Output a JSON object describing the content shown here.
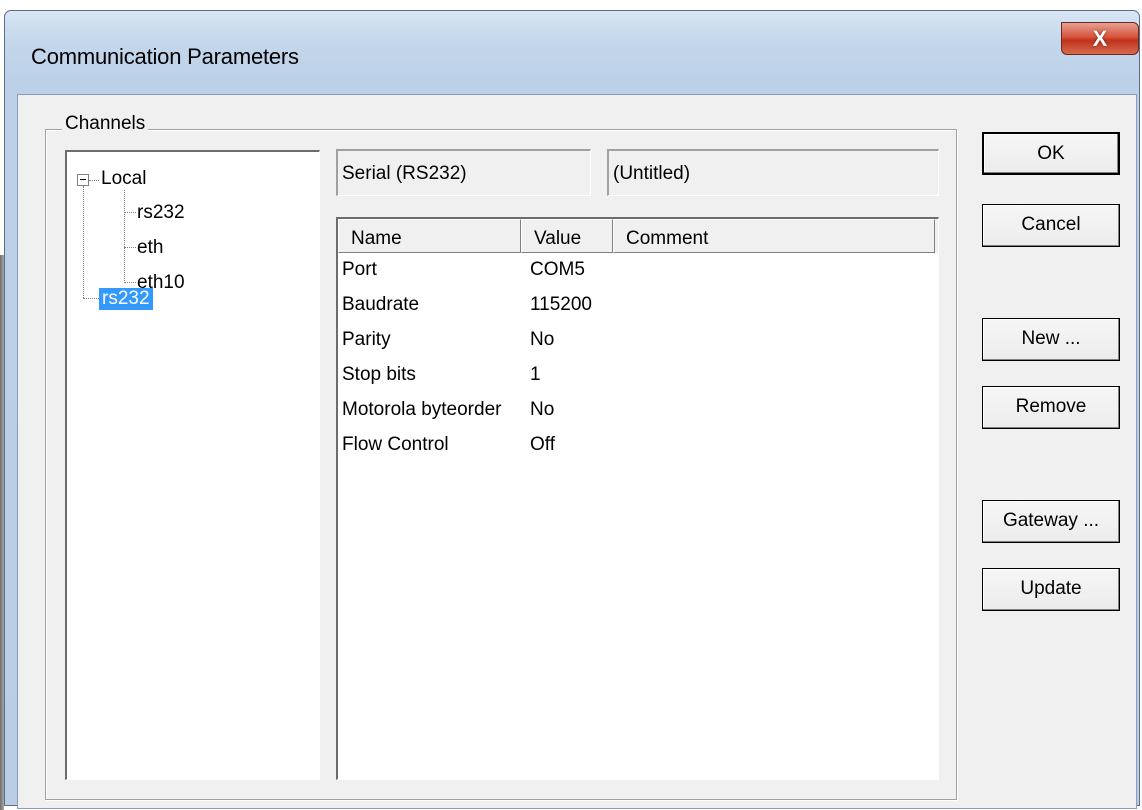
{
  "window": {
    "title": "Communication Parameters",
    "close_glyph": "X"
  },
  "channels": {
    "group_label": "Channels",
    "tree": [
      {
        "label": "Local"
      },
      {
        "label": "rs232"
      },
      {
        "label": "eth"
      },
      {
        "label": "eth10"
      },
      {
        "label": "rs232",
        "selected": true
      }
    ]
  },
  "driver_field": "Serial (RS232)",
  "name_field": "(Untitled)",
  "grid": {
    "columns": [
      "Name",
      "Value",
      "Comment"
    ],
    "rows": [
      {
        "name": "Port",
        "value": "COM5",
        "comment": ""
      },
      {
        "name": "Baudrate",
        "value": "115200",
        "comment": ""
      },
      {
        "name": "Parity",
        "value": "No",
        "comment": ""
      },
      {
        "name": "Stop bits",
        "value": "1",
        "comment": ""
      },
      {
        "name": "Motorola byteorder",
        "value": "No",
        "comment": ""
      },
      {
        "name": "Flow Control",
        "value": "Off",
        "comment": ""
      }
    ]
  },
  "buttons": {
    "ok": "OK",
    "cancel": "Cancel",
    "new": "New ...",
    "remove": "Remove",
    "gateway": "Gateway ...",
    "update": "Update"
  },
  "colors": {
    "selection": "#3399ff",
    "close": "#c0311b",
    "face": "#f0f0f0"
  }
}
